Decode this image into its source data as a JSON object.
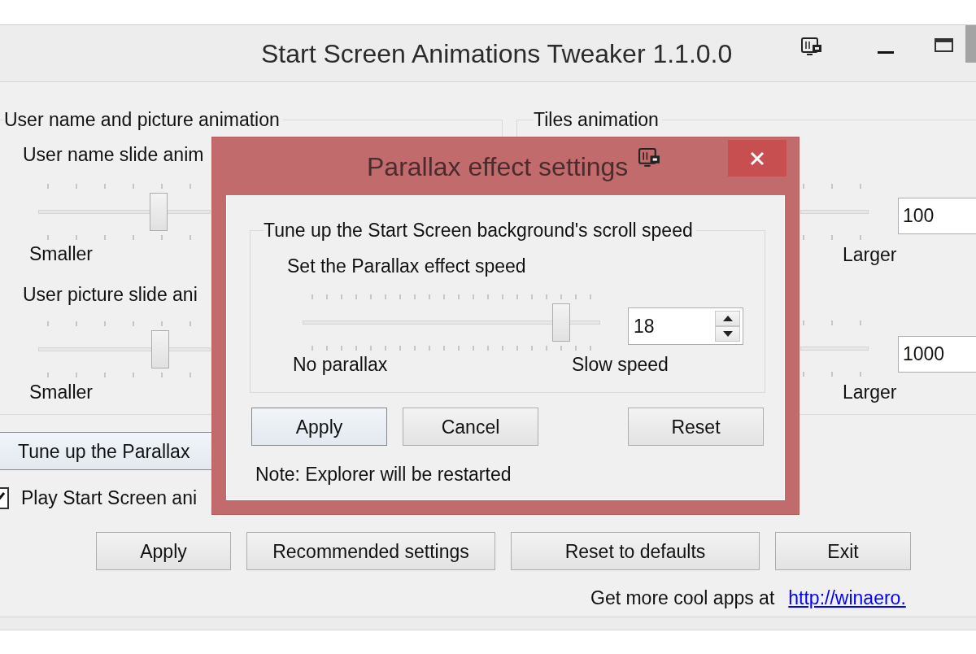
{
  "window": {
    "title": "Start Screen Animations Tweaker 1.1.0.0"
  },
  "user_animation_group": {
    "title": "User name and picture animation",
    "sliders": [
      {
        "label": "User name slide anim",
        "level": 0.7,
        "min_label": "Smaller"
      },
      {
        "label": "User picture slide ani",
        "level": 0.71,
        "min_label": "Smaller"
      }
    ]
  },
  "tiles_group": {
    "title": "Tiles animation",
    "sliders": [
      {
        "max_label": "Larger",
        "value": "100"
      },
      {
        "max_label": "Larger",
        "value": "1000"
      }
    ]
  },
  "parallax_button": {
    "label": "Tune up the Parallax",
    "focused": true
  },
  "play_animations": {
    "label": "Play Start Screen ani",
    "checked": true
  },
  "buttons": [
    "Apply",
    "Recommended settings",
    "Reset to defaults",
    "Exit"
  ],
  "footer": {
    "text": "Get more cool apps at",
    "link": "http://winaero."
  },
  "dialog": {
    "title": "Parallax effect settings",
    "group_title": "Tune up the Start Screen background's scroll speed",
    "slider": {
      "label": "Set the Parallax effect speed",
      "level": 0.87,
      "min_label": "No parallax",
      "max_label": "Slow speed",
      "value": "18"
    },
    "buttons": [
      {
        "label": "Apply",
        "focused": true
      },
      {
        "label": "Cancel",
        "focused": false
      },
      {
        "label": "Reset",
        "focused": false
      }
    ],
    "note": "Note: Explorer will be restarted"
  }
}
